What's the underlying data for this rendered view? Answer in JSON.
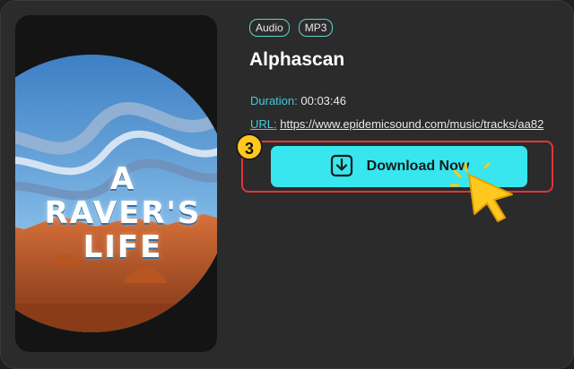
{
  "tags": [
    "Audio",
    "MP3"
  ],
  "cover": {
    "line1": "A",
    "line2": "RAVER'S",
    "line3": "LIFE"
  },
  "track": {
    "title": "Alphascan",
    "duration_label": "Duration:",
    "duration_value": "00:03:46",
    "url_label": "URL:",
    "url_value": "https://www.epidemicsound.com/music/tracks/aa82"
  },
  "step": {
    "number": "3"
  },
  "download": {
    "label": "Download Now",
    "icon": "download-icon"
  },
  "colors": {
    "accent": "#37e6ee",
    "tag_border": "#5fd6c8",
    "highlight": "#e23535",
    "badge": "#ffc81e",
    "cursor": "#ffc81e"
  }
}
